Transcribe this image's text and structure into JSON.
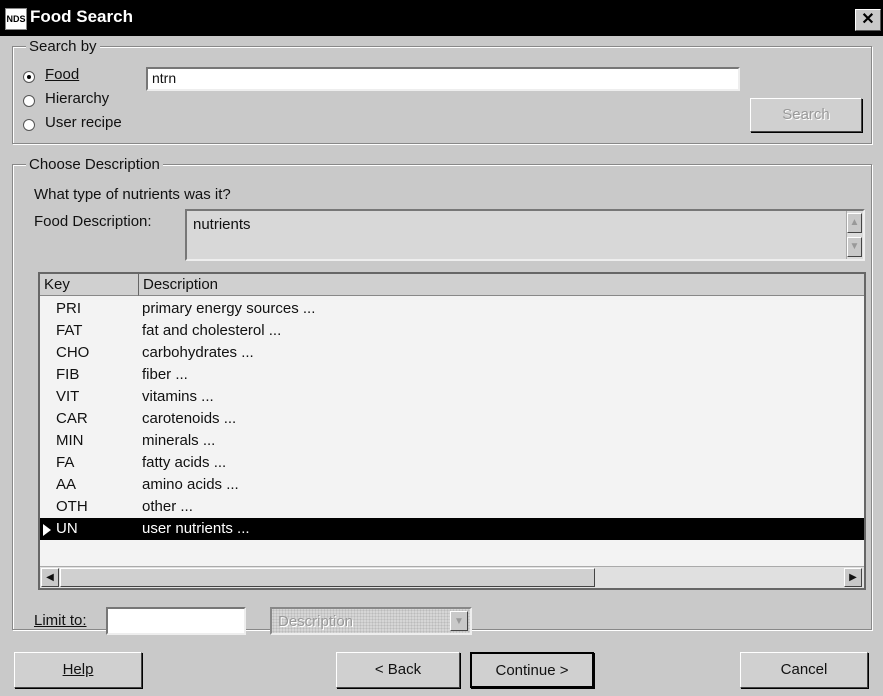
{
  "window": {
    "title": "Food Search",
    "icon_text": "NDS"
  },
  "search_by": {
    "legend": "Search by",
    "options": [
      {
        "label": "Food",
        "checked": true
      },
      {
        "label": "Hierarchy",
        "checked": false
      },
      {
        "label": "User recipe",
        "checked": false
      }
    ],
    "query_value": "ntrn",
    "search_button": "Search"
  },
  "choose_description": {
    "legend": "Choose Description",
    "prompt": "What type of nutrients was it?",
    "food_description_label": "Food Description:",
    "food_description_value": "nutrients"
  },
  "table": {
    "columns": [
      "Key",
      "Description"
    ],
    "rows": [
      {
        "key": "PRI",
        "description": "primary energy sources ..."
      },
      {
        "key": "FAT",
        "description": "fat and cholesterol ..."
      },
      {
        "key": "CHO",
        "description": "carbohydrates ..."
      },
      {
        "key": "FIB",
        "description": "fiber ..."
      },
      {
        "key": "VIT",
        "description": "vitamins ..."
      },
      {
        "key": "CAR",
        "description": "carotenoids ..."
      },
      {
        "key": "MIN",
        "description": "minerals ..."
      },
      {
        "key": "FA",
        "description": "fatty acids ..."
      },
      {
        "key": "AA",
        "description": "amino acids ..."
      },
      {
        "key": "OTH",
        "description": "other ..."
      },
      {
        "key": "UN",
        "description": "user nutrients ..."
      }
    ],
    "selected_index": 10
  },
  "limit": {
    "label": "Limit to:",
    "value": "",
    "select_value": "Description"
  },
  "buttons": {
    "help": "Help",
    "back": "< Back",
    "continue": "Continue >",
    "cancel": "Cancel"
  }
}
